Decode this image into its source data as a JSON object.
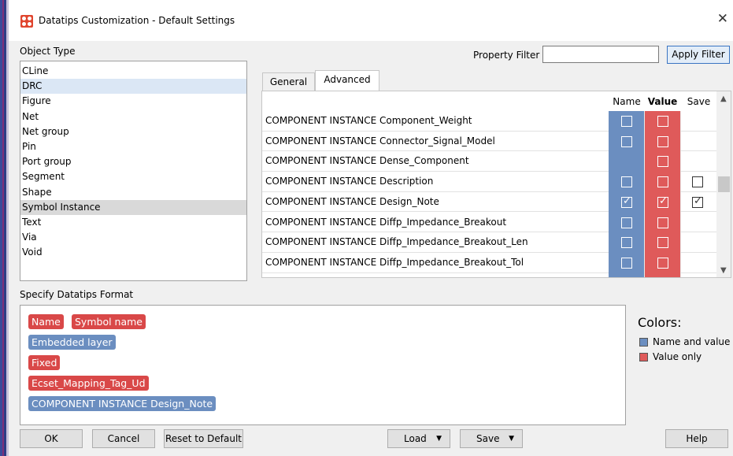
{
  "window": {
    "title": "Datatips Customization - Default Settings",
    "close_glyph": "✕"
  },
  "object_type": {
    "label": "Object Type",
    "items": [
      "CLine",
      "DRC",
      "Figure",
      "Net",
      "Net group",
      "Pin",
      "Port group",
      "Segment",
      "Shape",
      "Symbol Instance",
      "Text",
      "Via",
      "Void"
    ],
    "highlighted_item": "DRC",
    "selected_item": "Symbol Instance"
  },
  "property_filter": {
    "label": "Property Filter",
    "value": "",
    "apply_label": "Apply Filter"
  },
  "tabs": [
    {
      "label": "General",
      "active": false
    },
    {
      "label": "Advanced",
      "active": true
    }
  ],
  "table": {
    "headers": {
      "name": "Name",
      "value": "Value",
      "save": "Save"
    },
    "rows": [
      {
        "property": "COMPONENT INSTANCE Component_Weight",
        "name": false,
        "value": false,
        "save": null
      },
      {
        "property": "COMPONENT INSTANCE Connector_Signal_Model",
        "name": false,
        "value": false,
        "save": null
      },
      {
        "property": "COMPONENT INSTANCE Dense_Component",
        "name": null,
        "value": false,
        "save": null
      },
      {
        "property": "COMPONENT INSTANCE Description",
        "name": false,
        "value": false,
        "save": false
      },
      {
        "property": "COMPONENT INSTANCE Design_Note",
        "name": true,
        "value": true,
        "save": true
      },
      {
        "property": "COMPONENT INSTANCE Diffp_Impedance_Breakout",
        "name": false,
        "value": false,
        "save": null
      },
      {
        "property": "COMPONENT INSTANCE Diffp_Impedance_Breakout_Len",
        "name": false,
        "value": false,
        "save": null
      },
      {
        "property": "COMPONENT INSTANCE Diffp_Impedance_Breakout_Tol",
        "name": false,
        "value": false,
        "save": null
      }
    ]
  },
  "format": {
    "label": "Specify Datatips Format",
    "tags": [
      {
        "text": "Name",
        "kind": "value_only"
      },
      {
        "text": "Symbol name",
        "kind": "value_only"
      },
      {
        "text": "Embedded layer",
        "kind": "name_and_value"
      },
      {
        "text": "Fixed",
        "kind": "value_only"
      },
      {
        "text": "Ecset_Mapping_Tag_Ud",
        "kind": "value_only"
      },
      {
        "text": "COMPONENT INSTANCE Design_Note",
        "kind": "name_and_value"
      }
    ]
  },
  "colors": {
    "title": "Colors:",
    "name_and_value": {
      "label": "Name and value",
      "color": "#6b8ec0"
    },
    "value_only": {
      "label": "Value only",
      "color": "#df5a5a"
    }
  },
  "buttons": {
    "ok": "OK",
    "cancel": "Cancel",
    "reset": "Reset to Default",
    "load": "Load",
    "save": "Save",
    "help": "Help"
  }
}
